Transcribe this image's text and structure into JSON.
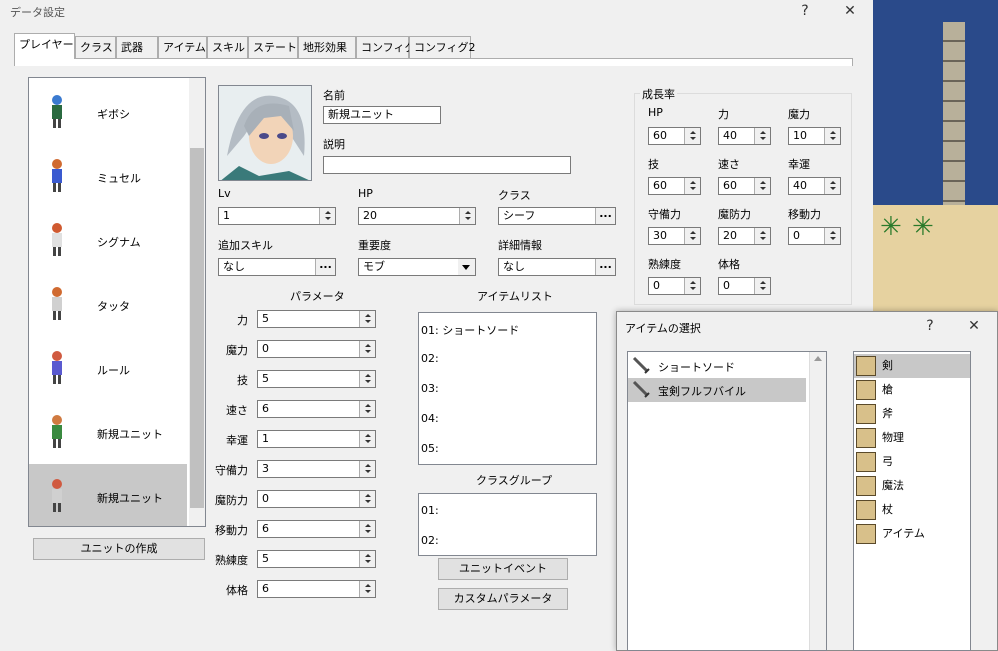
{
  "main_window": {
    "title": "データ設定",
    "help_glyph": "?",
    "close_glyph": "✕"
  },
  "tabs": [
    "プレイヤー",
    "クラス",
    "武器",
    "アイテム",
    "スキル",
    "ステート",
    "地形効果",
    "コンフィグ",
    "コンフィグ2"
  ],
  "units": [
    "ギボシ",
    "ミュセル",
    "シグナム",
    "タッタ",
    "ルール",
    "新規ユニット",
    "新規ユニット"
  ],
  "create_unit_button": "ユニットの作成",
  "unit": {
    "name_label": "名前",
    "name_value": "新規ユニット",
    "desc_label": "説明",
    "desc_value": "",
    "lv_label": "Lv",
    "lv_value": "1",
    "hp_label": "HP",
    "hp_value": "20",
    "class_label": "クラス",
    "class_value": "シーフ",
    "skill_label": "追加スキル",
    "skill_value": "なし",
    "importance_label": "重要度",
    "importance_value": "モブ",
    "detail_label": "詳細情報",
    "detail_value": "なし"
  },
  "params": {
    "title": "パラメータ",
    "rows": [
      {
        "label": "力",
        "value": "5"
      },
      {
        "label": "魔力",
        "value": "0"
      },
      {
        "label": "技",
        "value": "5"
      },
      {
        "label": "速さ",
        "value": "6"
      },
      {
        "label": "幸運",
        "value": "1"
      },
      {
        "label": "守備力",
        "value": "3"
      },
      {
        "label": "魔防力",
        "value": "0"
      },
      {
        "label": "移動力",
        "value": "6"
      },
      {
        "label": "熟練度",
        "value": "5"
      },
      {
        "label": "体格",
        "value": "6"
      }
    ]
  },
  "item_list": {
    "title": "アイテムリスト",
    "rows": [
      "01: ショートソード",
      "02:",
      "03:",
      "04:",
      "05:"
    ]
  },
  "class_group": {
    "title": "クラスグループ",
    "rows": [
      "01:",
      "02:"
    ]
  },
  "unit_event_button": "ユニットイベント",
  "custom_param_button": "カスタムパラメータ",
  "growth": {
    "title": "成長率",
    "cells": [
      {
        "label": "HP",
        "value": "60"
      },
      {
        "label": "力",
        "value": "40"
      },
      {
        "label": "魔力",
        "value": "10"
      },
      {
        "label": "技",
        "value": "60"
      },
      {
        "label": "速さ",
        "value": "60"
      },
      {
        "label": "幸運",
        "value": "40"
      },
      {
        "label": "守備力",
        "value": "30"
      },
      {
        "label": "魔防力",
        "value": "20"
      },
      {
        "label": "移動力",
        "value": "0"
      },
      {
        "label": "熟練度",
        "value": "0"
      },
      {
        "label": "体格",
        "value": "0"
      }
    ]
  },
  "item_dialog": {
    "title": "アイテムの選択",
    "help_glyph": "?",
    "close_glyph": "✕",
    "items": [
      "ショートソード",
      "宝剣フルフバイル"
    ],
    "categories": [
      "剣",
      "槍",
      "斧",
      "物理",
      "弓",
      "魔法",
      "杖",
      "アイテム"
    ]
  },
  "colors": {
    "selection": "#c8c8c8",
    "dialog_bg": "#f0f0f0",
    "water": "#2a4a8a",
    "sand": "#e6d2a0"
  }
}
